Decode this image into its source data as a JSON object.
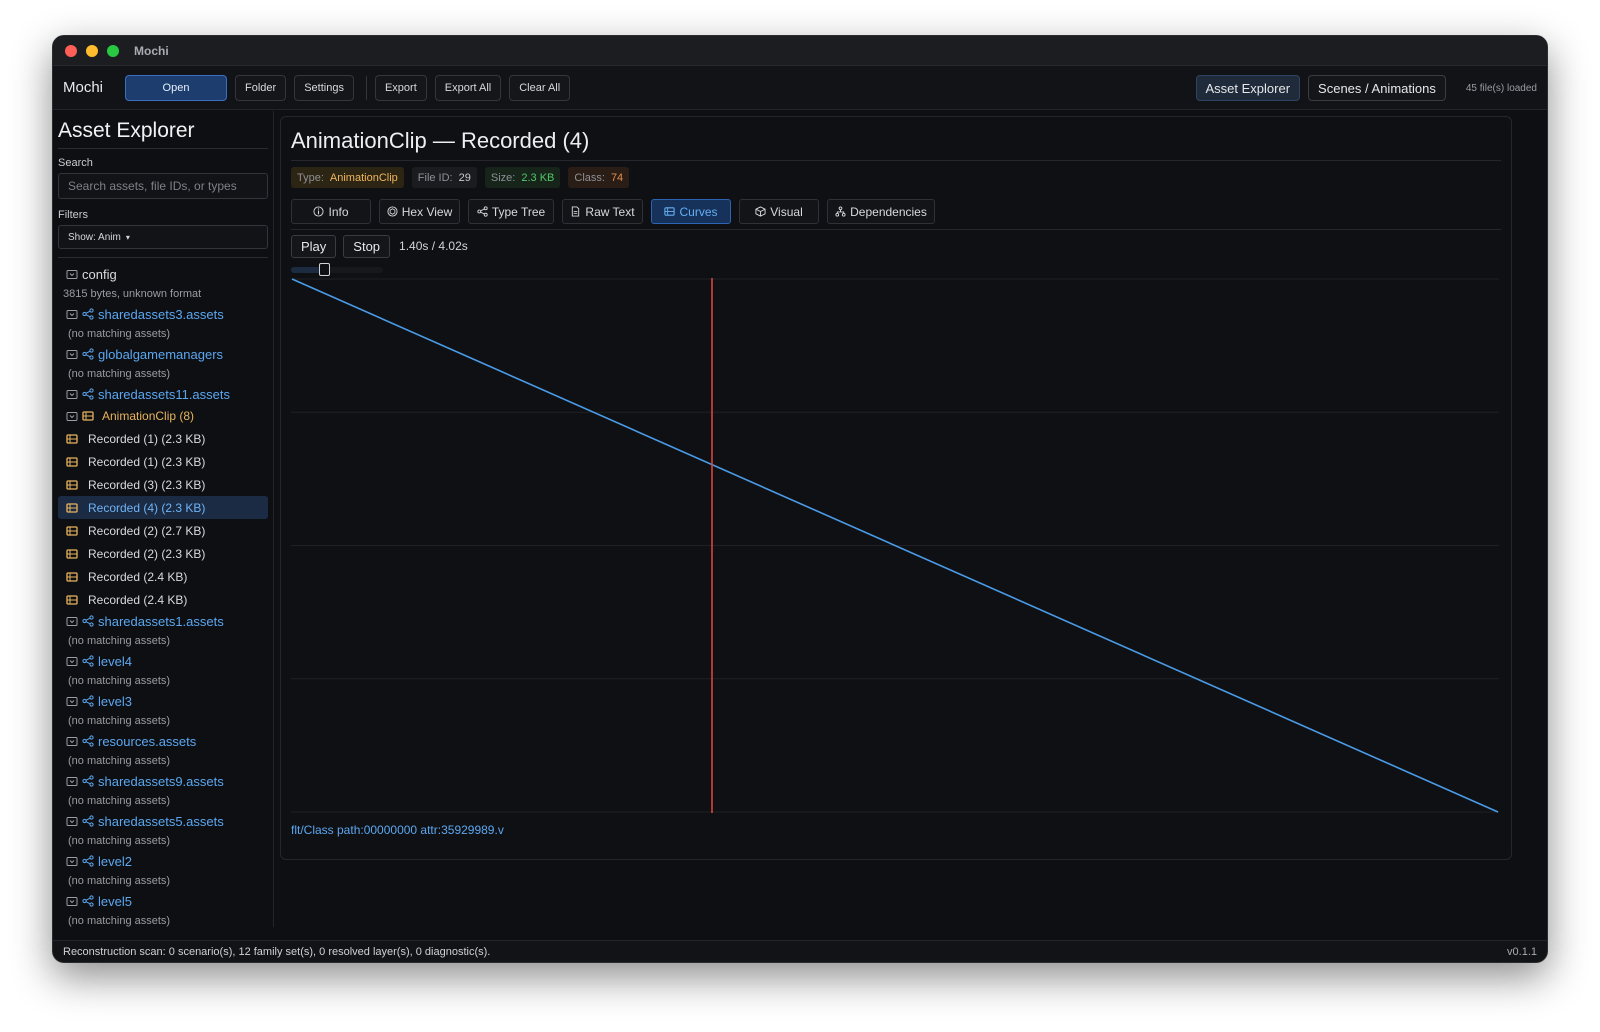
{
  "window": {
    "title": "Mochi"
  },
  "toolbar": {
    "brand": "Mochi",
    "open": "Open",
    "folder": "Folder",
    "settings": "Settings",
    "export": "Export",
    "export_all": "Export All",
    "clear_all": "Clear All",
    "nav_asset_explorer": "Asset Explorer",
    "nav_scenes": "Scenes / Animations",
    "files_loaded": "45 file(s) loaded"
  },
  "sidebar": {
    "title": "Asset Explorer",
    "search_label": "Search",
    "search_placeholder": "Search assets, file IDs, or types",
    "filters_label": "Filters",
    "filter_value": "Show: Anim",
    "tree": {
      "config": {
        "label": "config",
        "sub": "3815 bytes, unknown format"
      },
      "files": [
        {
          "label": "sharedassets3.assets",
          "sub": "(no matching assets)"
        },
        {
          "label": "globalgamemanagers",
          "sub": "(no matching assets)"
        },
        {
          "label": "sharedassets11.assets"
        }
      ],
      "clip_group": "AnimationClip (8)",
      "clips": [
        "Recorded (1) (2.3 KB)",
        "Recorded (1) (2.3 KB)",
        "Recorded (3) (2.3 KB)",
        "Recorded (4) (2.3 KB)",
        "Recorded (2) (2.7 KB)",
        "Recorded (2) (2.3 KB)",
        "Recorded (2.4 KB)",
        "Recorded (2.4 KB)"
      ],
      "files_after": [
        {
          "label": "sharedassets1.assets",
          "sub": "(no matching assets)"
        },
        {
          "label": "level4",
          "sub": "(no matching assets)"
        },
        {
          "label": "level3",
          "sub": "(no matching assets)"
        },
        {
          "label": "resources.assets",
          "sub": "(no matching assets)"
        },
        {
          "label": "sharedassets9.assets",
          "sub": "(no matching assets)"
        },
        {
          "label": "sharedassets5.assets",
          "sub": "(no matching assets)"
        },
        {
          "label": "level2",
          "sub": "(no matching assets)"
        },
        {
          "label": "level5",
          "sub": "(no matching assets)"
        }
      ]
    }
  },
  "main": {
    "title": "AnimationClip — Recorded (4)",
    "badges": {
      "type_label": "Type:",
      "type_value": "AnimationClip",
      "fileid_label": "File ID:",
      "fileid_value": "29",
      "size_label": "Size:",
      "size_value": "2.3 KB",
      "class_label": "Class:",
      "class_value": "74"
    },
    "tabs": {
      "info": "Info",
      "hex": "Hex View",
      "typetree": "Type Tree",
      "rawtext": "Raw Text",
      "curves": "Curves",
      "visual": "Visual",
      "deps": "Dependencies"
    },
    "player": {
      "play": "Play",
      "stop": "Stop",
      "time": "1.40s / 4.02s",
      "current": 1.4,
      "duration": 4.02
    },
    "curve_label": "flt/Class path:00000000 attr:35929989.v"
  },
  "chart_data": {
    "type": "line",
    "x": [
      0,
      4.02
    ],
    "series": [
      {
        "values": [
          1,
          0
        ]
      }
    ],
    "xlim": [
      0,
      4.02
    ],
    "ylim": [
      0,
      1
    ],
    "grid": true,
    "playhead": 1.4,
    "colors": {
      "line": "#4a9be8",
      "playhead": "#d9443d",
      "grid": "#1e2025"
    }
  },
  "status": {
    "text": "Reconstruction scan: 0 scenario(s), 12 family set(s), 0 resolved layer(s), 0 diagnostic(s).",
    "version": "v0.1.1"
  }
}
